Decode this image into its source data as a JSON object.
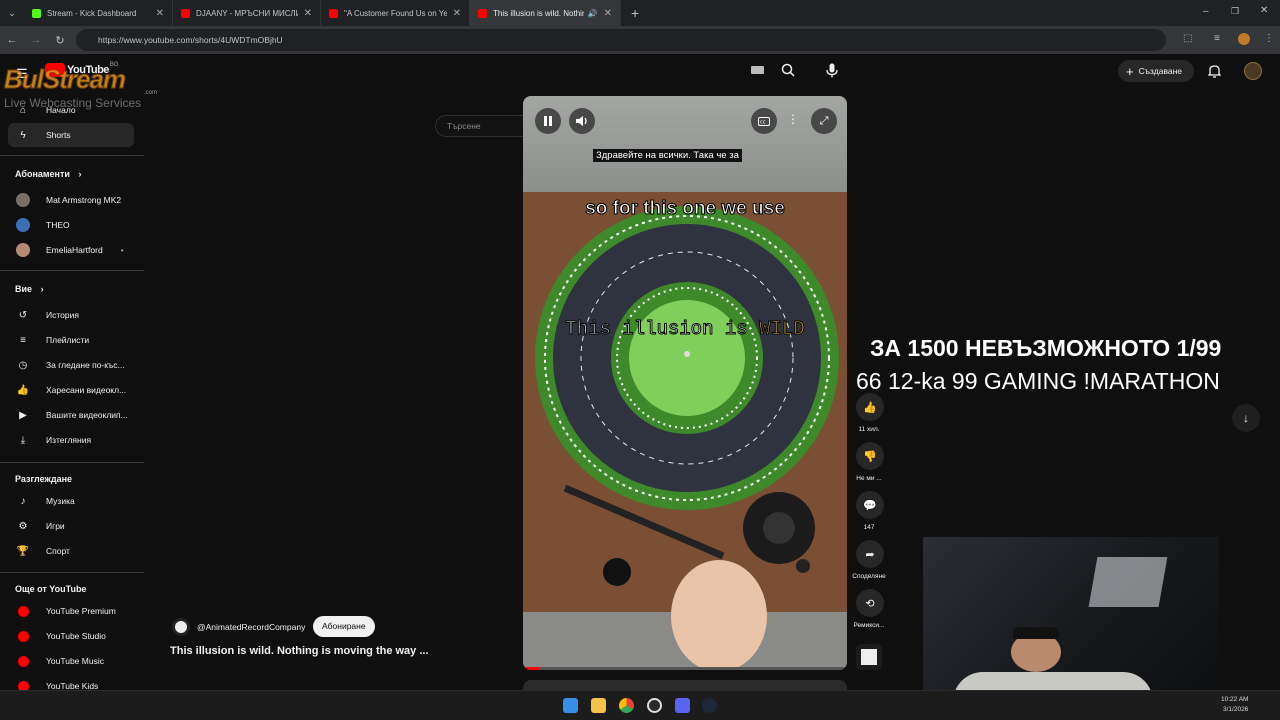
{
  "browser": {
    "tabs": [
      {
        "title": "Stream - Kick Dashboard",
        "color": "#53fc18"
      },
      {
        "title": "DJAANY - МРЪСНИ МИСЛИ (",
        "color": "#ff0000"
      },
      {
        "title": "\"A Customer Found Us on Yelp",
        "color": "#ff0000"
      },
      {
        "title": "This illusion is wild. Nothing",
        "color": "#ff0000"
      }
    ],
    "url": "https://www.youtube.com/shorts/4UWDTmOBjhU"
  },
  "stream_logo": {
    "main": "BulStream",
    "sub": "Live Webcasting Services",
    "domain": ".com"
  },
  "yt_logo": {
    "text": "YouTube",
    "region": "BG"
  },
  "search": {
    "placeholder": "Търсене"
  },
  "header": {
    "create_label": "Създаване"
  },
  "sidebar": {
    "main": [
      {
        "label": "Начало",
        "icon": "home-icon"
      },
      {
        "label": "Shorts",
        "icon": "shorts-icon"
      }
    ],
    "subs_title": "Абонаменти",
    "subs": [
      {
        "label": "Mat Armstrong MK2",
        "color": "#7a6f66"
      },
      {
        "label": "THEO",
        "color": "#3b6fb6"
      },
      {
        "label": "EmeliaHartford",
        "color": "#b58a74",
        "dot": "•"
      }
    ],
    "you_title": "Вие",
    "you": [
      {
        "label": "История",
        "icon": "history-icon"
      },
      {
        "label": "Плейлисти",
        "icon": "playlist-icon"
      },
      {
        "label": "За гледане по-къс...",
        "icon": "clock-icon"
      },
      {
        "label": "Харесани видеокл...",
        "icon": "like-icon"
      },
      {
        "label": "Вашите видеоклип...",
        "icon": "your-videos-icon"
      },
      {
        "label": "Изтегляния",
        "icon": "download-icon"
      }
    ],
    "explore_title": "Разглеждане",
    "explore": [
      {
        "label": "Музика",
        "icon": "music-icon"
      },
      {
        "label": "Игри",
        "icon": "gamepad-icon"
      },
      {
        "label": "Спорт",
        "icon": "trophy-icon"
      }
    ],
    "more_title": "Още от YouTube",
    "more": [
      {
        "label": "YouTube Premium"
      },
      {
        "label": "YouTube Studio"
      },
      {
        "label": "YouTube Music"
      },
      {
        "label": "YouTube Kids"
      }
    ]
  },
  "video": {
    "cc_text": "Здравейте на всички. Така че за",
    "cap1": "so for this one we use",
    "cap2_a": "This illusion is",
    "cap2_b": "WILD",
    "channel": "@AnimatedRecordCompany",
    "subscribe": "Абониране",
    "title": "This illusion is wild. Nothing is moving the way ..."
  },
  "actions": {
    "likes": "11 хил.",
    "dislike": "Не ми ...",
    "comments": "147",
    "share": "Споделяне",
    "remix": "Ремикси..."
  },
  "stream_overlay": {
    "line1": "ЗА 1500 НЕВЪЗМОЖНОТО 1/99",
    "line2": "66 12-ka 99 GAMING !MARATHON"
  },
  "taskbar": {
    "time": "10:22 AM",
    "date": "3/1/2026"
  }
}
